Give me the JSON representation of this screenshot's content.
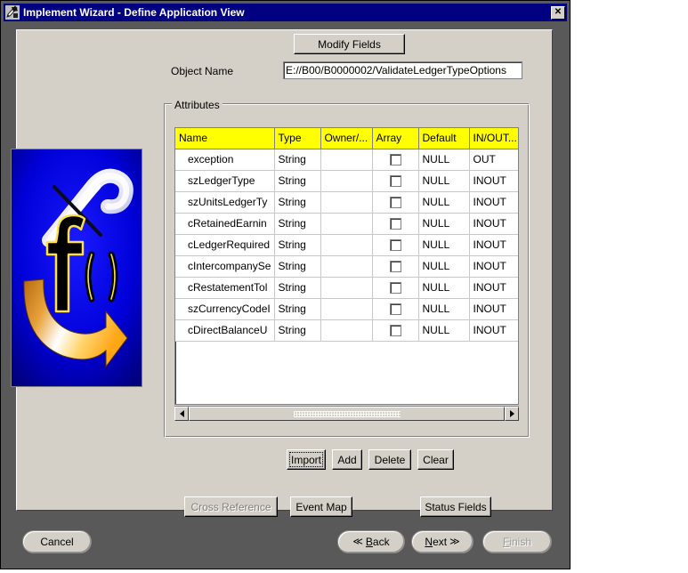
{
  "window": {
    "title": "Implement Wizard - Define Application View",
    "icon": "wizard-pen-icon",
    "close_label": "✕"
  },
  "colors": {
    "titlebar": "#000080",
    "face": "#d4d0c8",
    "desktop": "#595959",
    "header_highlight": "#ffff00",
    "art_background": "#0000d0"
  },
  "form": {
    "modify_fields_label": "Modify Fields",
    "object_name_label": "Object Name",
    "object_name_value": "E://B00/B0000002/ValidateLedgerTypeOptions",
    "object_name_placeholder": ""
  },
  "attributes": {
    "legend": "Attributes",
    "columns": [
      "Name",
      "Type",
      "Owner/...",
      "Array",
      "Default",
      "IN/OUT..."
    ],
    "rows": [
      {
        "name": "exception",
        "type": "String",
        "owner": "",
        "array": false,
        "default": "NULL",
        "inout": "OUT"
      },
      {
        "name": "szLedgerType",
        "type": "String",
        "owner": "",
        "array": false,
        "default": "NULL",
        "inout": "INOUT"
      },
      {
        "name": "szUnitsLedgerTy",
        "type": "String",
        "owner": "",
        "array": false,
        "default": "NULL",
        "inout": "INOUT"
      },
      {
        "name": "cRetainedEarnin",
        "type": "String",
        "owner": "",
        "array": false,
        "default": "NULL",
        "inout": "INOUT"
      },
      {
        "name": "cLedgerRequired",
        "type": "String",
        "owner": "",
        "array": false,
        "default": "NULL",
        "inout": "INOUT"
      },
      {
        "name": "cIntercompanySe",
        "type": "String",
        "owner": "",
        "array": false,
        "default": "NULL",
        "inout": "INOUT"
      },
      {
        "name": "cRestatementTol",
        "type": "String",
        "owner": "",
        "array": false,
        "default": "NULL",
        "inout": "INOUT"
      },
      {
        "name": "szCurrencyCodeI",
        "type": "String",
        "owner": "",
        "array": false,
        "default": "NULL",
        "inout": "INOUT"
      },
      {
        "name": "cDirectBalanceU",
        "type": "String",
        "owner": "",
        "array": false,
        "default": "NULL",
        "inout": "INOUT"
      }
    ]
  },
  "scrollbar": {
    "left_arrow": "◀",
    "right_arrow": "▶"
  },
  "table_buttons": {
    "import": "Import",
    "add": "Add",
    "delete": "Delete",
    "clear": "Clear"
  },
  "secondary_buttons": {
    "cross_reference": "Cross Reference",
    "event_map": "Event Map",
    "status_fields": "Status Fields"
  },
  "nav_buttons": {
    "cancel": "Cancel",
    "back_chevron": "≪",
    "back_first": "B",
    "back_rest": "ack",
    "next_first": "N",
    "next_rest": "ext",
    "next_chevron": "≫",
    "finish_first": "F",
    "finish_rest": "inish"
  }
}
